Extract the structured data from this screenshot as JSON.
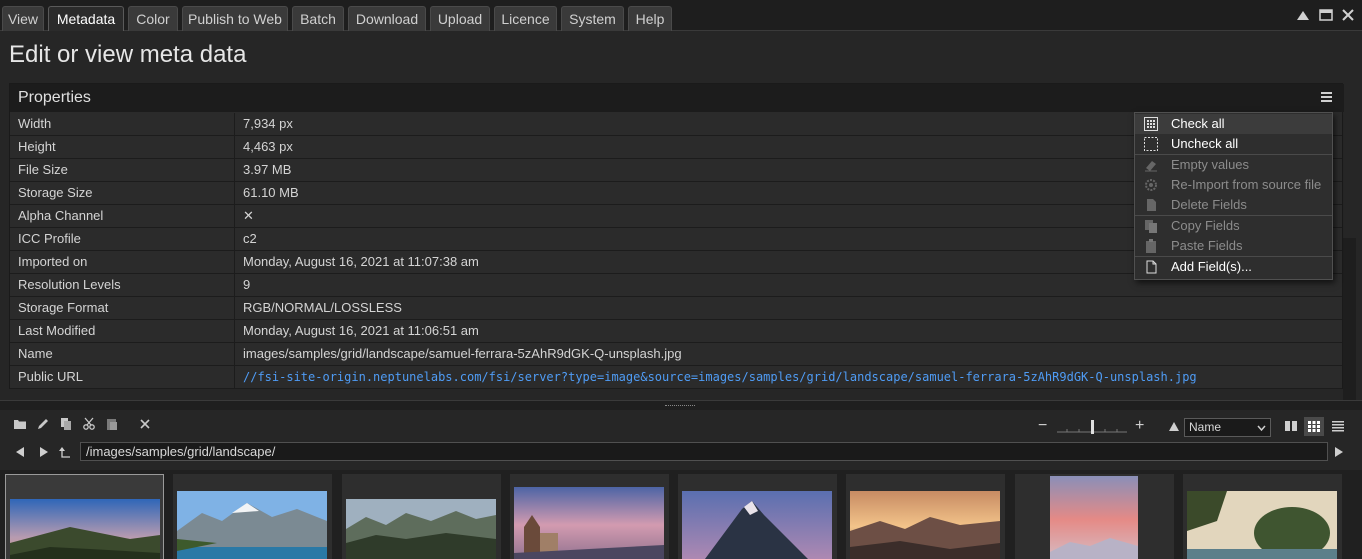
{
  "tabs": [
    {
      "label": "View"
    },
    {
      "label": "Metadata"
    },
    {
      "label": "Color"
    },
    {
      "label": "Publish to Web"
    },
    {
      "label": "Batch"
    },
    {
      "label": "Download"
    },
    {
      "label": "Upload"
    },
    {
      "label": "Licence"
    },
    {
      "label": "System"
    },
    {
      "label": "Help"
    }
  ],
  "active_tab": "Metadata",
  "page_title": "Edit or view meta data",
  "properties": {
    "title": "Properties",
    "rows": [
      {
        "key": "Width",
        "value": "7,934 px"
      },
      {
        "key": "Height",
        "value": "4,463 px"
      },
      {
        "key": "File Size",
        "value": "3.97 MB"
      },
      {
        "key": "Storage Size",
        "value": "61.10 MB"
      },
      {
        "key": "Alpha Channel",
        "value": "✕"
      },
      {
        "key": "ICC Profile",
        "value": "c2"
      },
      {
        "key": "Imported on",
        "value": "Monday, August 16, 2021 at 11:07:38 am"
      },
      {
        "key": "Resolution Levels",
        "value": "9"
      },
      {
        "key": "Storage Format",
        "value": "RGB/NORMAL/LOSSLESS"
      },
      {
        "key": "Last Modified",
        "value": "Monday, August 16, 2021 at 11:06:51 am"
      },
      {
        "key": "Name",
        "value": "images/samples/grid/landscape/samuel-ferrara-5zAhR9dGK-Q-unsplash.jpg"
      },
      {
        "key": "Public URL",
        "value": "//fsi-site-origin.neptunelabs.com/fsi/server?type=image&source=images/samples/grid/landscape/samuel-ferrara-5zAhR9dGK-Q-unsplash.jpg"
      }
    ]
  },
  "context_menu": {
    "items": [
      {
        "label": "Check all",
        "enabled": true,
        "icon": "check-all-icon"
      },
      {
        "label": "Uncheck all",
        "enabled": true,
        "icon": "uncheck-all-icon"
      },
      {
        "label": "Empty values",
        "enabled": false,
        "icon": "eraser-icon"
      },
      {
        "label": "Re-Import from source file",
        "enabled": false,
        "icon": "gear-icon"
      },
      {
        "label": "Delete Fields",
        "enabled": false,
        "icon": "delete-document-icon"
      },
      {
        "label": "Copy Fields",
        "enabled": false,
        "icon": "copy-icon"
      },
      {
        "label": "Paste Fields",
        "enabled": false,
        "icon": "paste-icon"
      },
      {
        "label": "Add Field(s)...",
        "enabled": true,
        "icon": "add-document-icon"
      }
    ]
  },
  "browser": {
    "zoom_minus": "−",
    "zoom_plus": "+",
    "sort_by": "Name",
    "path": "/images/samples/grid/landscape/",
    "thumbnail_count": 8
  },
  "colors": {
    "background": "#262626",
    "link": "#4f9cf5",
    "active_tab": "#2b2b2b"
  }
}
